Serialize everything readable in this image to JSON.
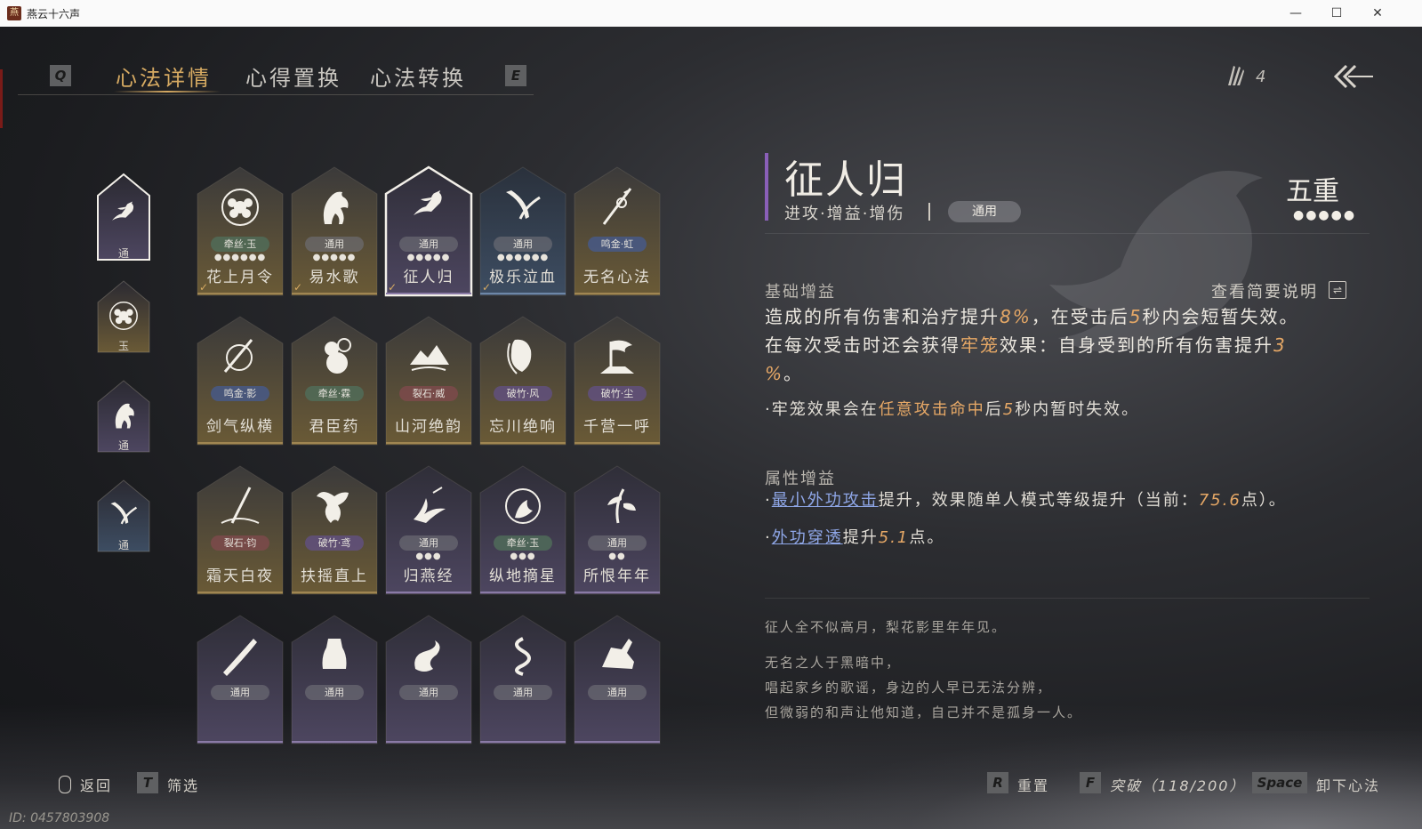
{
  "window": {
    "title": "燕云十六声",
    "icon_glyph": "燕",
    "minimize": "—",
    "maximize": "☐",
    "close": "✕"
  },
  "nav": {
    "prev_key": "Q",
    "next_key": "E",
    "tabs": [
      {
        "label": "心法详情",
        "active": true
      },
      {
        "label": "心得置换",
        "active": false
      },
      {
        "label": "心法转换",
        "active": false
      }
    ],
    "currency_value": "4",
    "currency_icon": "feather-bundle-icon",
    "back_icon": "back-arrow-icon"
  },
  "side_slots": [
    {
      "icon": "crow-hand-icon",
      "tag": "通",
      "selected": true
    },
    {
      "icon": "flower-seal-icon",
      "tag": "玉",
      "selected": false
    },
    {
      "icon": "horse-icon",
      "tag": "通",
      "selected": false
    },
    {
      "icon": "blade-slash-icon",
      "tag": "通",
      "selected": false
    }
  ],
  "cards": [
    {
      "name": "花上月令",
      "badge": "牵丝·玉",
      "tone": "green",
      "dots": "●●●●●●",
      "emblem": "flower-seal-icon",
      "theme": "gold",
      "equipped": true
    },
    {
      "name": "易水歌",
      "badge": "通用",
      "tone": "gray",
      "dots": "●●●●●",
      "emblem": "horse-icon",
      "theme": "gold",
      "equipped": true
    },
    {
      "name": "征人归",
      "badge": "通用",
      "tone": "gray",
      "dots": "●●●●●",
      "emblem": "crow-hand-icon",
      "theme": "purple",
      "equipped": true,
      "selected": true
    },
    {
      "name": "极乐泣血",
      "badge": "通用",
      "tone": "gray",
      "dots": "●●●●●●",
      "emblem": "blade-slash-icon",
      "theme": "blue",
      "equipped": true
    },
    {
      "name": "无名心法",
      "badge": "鸣金·虹",
      "tone": "blue",
      "dots": "",
      "emblem": "spear-icon",
      "theme": "gold",
      "equipped": false
    },
    {
      "name": "剑气纵横",
      "badge": "鸣金·影",
      "tone": "blue",
      "dots": "",
      "emblem": "sword-icon",
      "theme": "gold",
      "equipped": false
    },
    {
      "name": "君臣药",
      "badge": "牵丝·霖",
      "tone": "green",
      "dots": "",
      "emblem": "gourd-icon",
      "theme": "gold",
      "equipped": false
    },
    {
      "name": "山河绝韵",
      "badge": "裂石·威",
      "tone": "red",
      "dots": "",
      "emblem": "mountain-icon",
      "theme": "gold",
      "equipped": false
    },
    {
      "name": "忘川绝响",
      "badge": "破竹·风",
      "tone": "purple",
      "dots": "",
      "emblem": "mask-icon",
      "theme": "gold",
      "equipped": false
    },
    {
      "name": "千营一呼",
      "badge": "破竹·尘",
      "tone": "purple",
      "dots": "",
      "emblem": "flag-icon",
      "theme": "gold",
      "equipped": false
    },
    {
      "name": "霜天白夜",
      "badge": "裂石·钧",
      "tone": "red",
      "dots": "",
      "emblem": "staff-icon",
      "theme": "gold",
      "equipped": false
    },
    {
      "name": "扶摇直上",
      "badge": "破竹·鸢",
      "tone": "purple",
      "dots": "",
      "emblem": "eagle-icon",
      "theme": "gold",
      "equipped": false
    },
    {
      "name": "归燕经",
      "badge": "通用",
      "tone": "gray",
      "dots": "●●●",
      "emblem": "swallow-icon",
      "theme": "purple",
      "equipped": false
    },
    {
      "name": "纵地摘星",
      "badge": "牵丝·玉",
      "tone": "green",
      "dots": "●●●",
      "emblem": "star-orbit-icon",
      "theme": "purple",
      "equipped": false
    },
    {
      "name": "所恨年年",
      "badge": "通用",
      "tone": "gray",
      "dots": "●●",
      "emblem": "willow-icon",
      "theme": "purple",
      "equipped": false
    },
    {
      "name": "",
      "badge": "通用",
      "tone": "gray",
      "dots": "",
      "emblem": "broadsword-icon",
      "theme": "purple",
      "equipped": false
    },
    {
      "name": "",
      "badge": "通用",
      "tone": "gray",
      "dots": "",
      "emblem": "statue-icon",
      "theme": "purple",
      "equipped": false
    },
    {
      "name": "",
      "badge": "通用",
      "tone": "gray",
      "dots": "",
      "emblem": "dragon-icon",
      "theme": "purple",
      "equipped": false
    },
    {
      "name": "",
      "badge": "通用",
      "tone": "gray",
      "dots": "",
      "emblem": "serpent-icon",
      "theme": "purple",
      "equipped": false
    },
    {
      "name": "",
      "badge": "通用",
      "tone": "gray",
      "dots": "",
      "emblem": "boot-icon",
      "theme": "purple",
      "equipped": false
    }
  ],
  "detail": {
    "title": "征人归",
    "tags": "进攻·增益·增伤",
    "badge": "通用",
    "rank": "五重",
    "rank_dots": "●●●●●",
    "base_head": "基础增益",
    "brief_label": "查看简要说明",
    "brief_icon": "toggle-icon",
    "base_line1_a": "造成的所有伤害和治疗提升",
    "base_line1_num": "8%",
    "base_line1_b": "，在受击后",
    "base_line1_num2": "5",
    "base_line1_c": "秒内会短暂失效。",
    "base_line2_a": "在每次受击时还会获得",
    "base_line2_hl": "牢笼",
    "base_line2_b": "效果：自身受到的所有伤害提升",
    "base_line2_num": "3",
    "base_line3_num": "%",
    "base_line3_b": "。",
    "note_a": "·牢笼效果会在",
    "note_hl": "任意攻击命中",
    "note_b": "后",
    "note_num": "5",
    "note_c": "秒内暂时失效。",
    "attr_head": "属性增益",
    "attr1_dot": "·",
    "attr1_link": "最小外功攻击",
    "attr1_text": "提升，效果随单人模式等级提升（当前：",
    "attr1_num": "75.6",
    "attr1_end": "点）。",
    "attr2_dot": "·",
    "attr2_link": "外功穿透",
    "attr2_text": "提升",
    "attr2_num": "5.1",
    "attr2_end": "点。",
    "flavor1": "征人全不似高月，梨花影里年年见。",
    "flavor2": "无名之人于黑暗中，",
    "flavor3": "唱起家乡的歌谣，身边的人早已无法分辨，",
    "flavor4": "但微弱的和声让他知道，自己并不是孤身一人。"
  },
  "footer": {
    "back_label": "返回",
    "filter_key": "T",
    "filter_label": "筛选",
    "reset_key": "R",
    "reset_label": "重置",
    "break_key": "F",
    "break_label": "突破（118/200）",
    "unequip_key": "Space",
    "unequip_label": "卸下心法",
    "id_text": "ID: 0457803908"
  },
  "colors": {
    "accent_gold": "#d6aa62",
    "accent_purple": "#8a5fb8",
    "highlight": "#e6a866",
    "link": "#8fa7e8"
  }
}
